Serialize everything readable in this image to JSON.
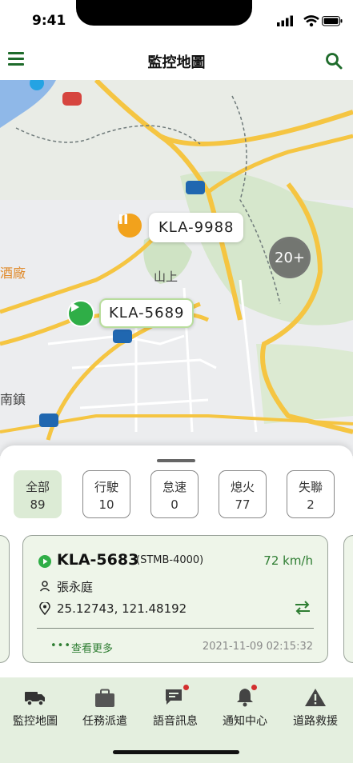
{
  "status_bar": {
    "time": "9:41"
  },
  "header": {
    "title": "監控地圖"
  },
  "map": {
    "cluster_label": "20+",
    "place_labels": [
      "山上",
      "酒廠",
      "南鎮"
    ],
    "vehicles": [
      {
        "plate": "KLA-9988",
        "state": "pause",
        "color": "#f2a21c"
      },
      {
        "plate": "KLA-5689",
        "state": "driving",
        "color": "#2fae47"
      }
    ]
  },
  "filters": [
    {
      "label": "全部",
      "count": "89",
      "active": true
    },
    {
      "label": "行駛",
      "count": "10"
    },
    {
      "label": "怠速",
      "count": "0"
    },
    {
      "label": "熄火",
      "count": "77"
    },
    {
      "label": "失聯",
      "count": "2"
    }
  ],
  "card": {
    "plate": "KLA-5683",
    "device": "(STMB-4000)",
    "speed": "72 km/h",
    "driver": "張永庭",
    "coordinates": "25.12743, 121.48192",
    "more_label": "查看更多",
    "timestamp": "2021-11-09 02:15:32"
  },
  "tabs": [
    {
      "label": "監控地圖",
      "icon": "truck-icon"
    },
    {
      "label": "任務派遣",
      "icon": "briefcase-icon"
    },
    {
      "label": "語音訊息",
      "icon": "chat-icon",
      "badge": true
    },
    {
      "label": "通知中心",
      "icon": "bell-icon",
      "badge": true
    },
    {
      "label": "道路救援",
      "icon": "warning-icon"
    }
  ],
  "colors": {
    "accent": "#1e6b2b",
    "driving": "#2fae47",
    "pause": "#f2a21c",
    "tab_bg": "#e4efdf"
  }
}
